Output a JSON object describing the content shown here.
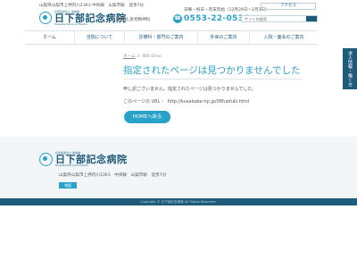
{
  "header": {
    "address": "山梨県山梨市上神内川1363 中央線　山梨市駅　徒歩7分",
    "logo_small": "社会医療法人 加納岩",
    "logo_name": "日下部記念病院",
    "logo_en": "Kusakabe Memorial Hospital",
    "departments": "精神科,思考精神科",
    "hours": "日曜・祝日・年末年始（12月29日～1月3日）",
    "phone_icon": "☎",
    "phone": "0553-22-0536",
    "access_label": "アクセス",
    "search_placeholder": "サイト内検索"
  },
  "nav": {
    "items": [
      {
        "label": "ホーム"
      },
      {
        "label": "当院について"
      },
      {
        "label": "診療科・部門のご案内"
      },
      {
        "label": "外来のご案内"
      },
      {
        "label": "入院・面会のご案内"
      }
    ]
  },
  "side_tab": {
    "label": "求人情報・働く方"
  },
  "breadcrumb": {
    "home": "ホーム",
    "sep": "＞",
    "current": "404 Error"
  },
  "error": {
    "title": "指定されたページは見つかりませんでした",
    "message": "申し訳ございません。指定されたページは見つかりませんでした。",
    "url_line": "このページの URL ： http://kusakabe-hp.jp/08fuefuki.html",
    "home_button": "HOMEへ戻る"
  },
  "footer": {
    "logo_small": "社会医療法人 加納岩",
    "logo_name": "日下部記念病院",
    "logo_en": "Kusakabe Memorial Hospital",
    "address": "山梨県山梨市上神内川1363　中央線　山梨市駅　徒歩7分",
    "map_button": "地図",
    "copyright": "Copyright © 日下部記念病院 All Rights Reserved."
  },
  "colors": {
    "accent": "#2aa2c8",
    "navy": "#1e5a7a",
    "footer_bg": "#f3f6f8"
  }
}
